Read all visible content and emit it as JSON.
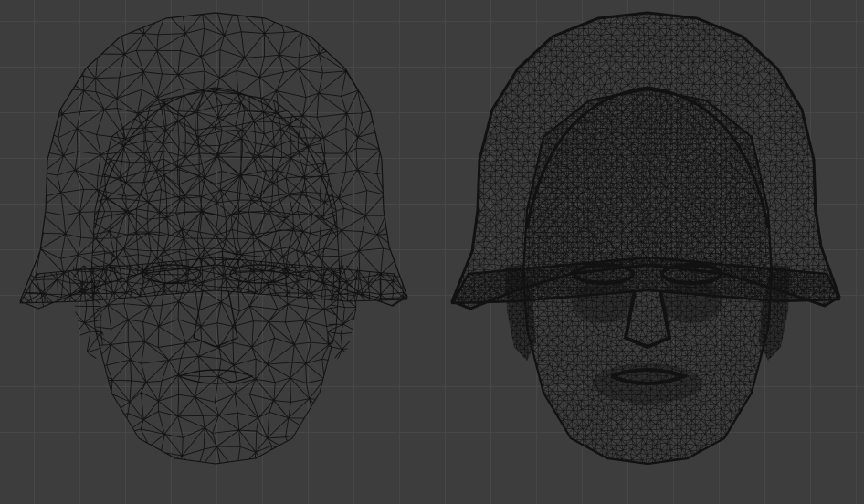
{
  "viewport": {
    "background_color": "#3d3d3d",
    "grid_color": "#474747",
    "axis_color": "#2b2b9a",
    "wire_color": "#111111"
  },
  "models": [
    {
      "id": "low-poly-helmet-head",
      "detail": "low"
    },
    {
      "id": "high-poly-helmet-head",
      "detail": "high"
    }
  ]
}
